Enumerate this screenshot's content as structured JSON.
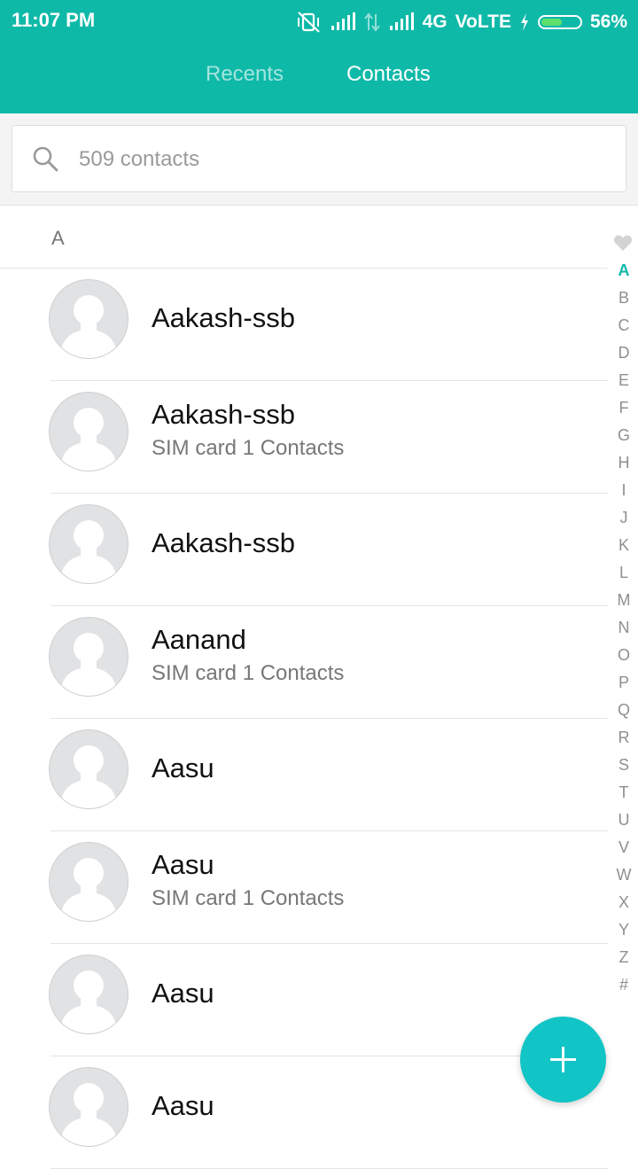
{
  "status_bar": {
    "time": "11:07 PM",
    "network": "4G",
    "volte": "VoLTE",
    "battery_percent": "56%",
    "battery_level": 0.56,
    "icons": [
      "vibrate-off-icon",
      "signal-icon",
      "data-arrows-icon",
      "signal-icon",
      "charging-icon",
      "battery-icon"
    ]
  },
  "tabs": [
    {
      "label": "Recents",
      "active": false
    },
    {
      "label": "Contacts",
      "active": true
    }
  ],
  "search": {
    "placeholder": "509 contacts",
    "icon": "search-icon"
  },
  "section": {
    "letter": "A"
  },
  "contacts": [
    {
      "name": "Aakash-ssb",
      "sub": ""
    },
    {
      "name": "Aakash-ssb",
      "sub": "SIM card 1 Contacts"
    },
    {
      "name": "Aakash-ssb",
      "sub": ""
    },
    {
      "name": "Aanand",
      "sub": "SIM card 1 Contacts"
    },
    {
      "name": "Aasu",
      "sub": ""
    },
    {
      "name": "Aasu",
      "sub": "SIM card 1 Contacts"
    },
    {
      "name": "Aasu",
      "sub": ""
    },
    {
      "name": "Aasu",
      "sub": ""
    }
  ],
  "index_bar": {
    "favorites_icon": "heart-icon",
    "letters": [
      "A",
      "B",
      "C",
      "D",
      "E",
      "F",
      "G",
      "H",
      "I",
      "J",
      "K",
      "L",
      "M",
      "N",
      "O",
      "P",
      "Q",
      "R",
      "S",
      "T",
      "U",
      "V",
      "W",
      "X",
      "Y",
      "Z",
      "#"
    ],
    "active": "A"
  },
  "fab": {
    "icon": "plus-icon"
  },
  "colors": {
    "accent": "#0fb9a8",
    "fab": "#11c4c5",
    "text_primary": "#111111",
    "text_secondary": "#777777"
  }
}
